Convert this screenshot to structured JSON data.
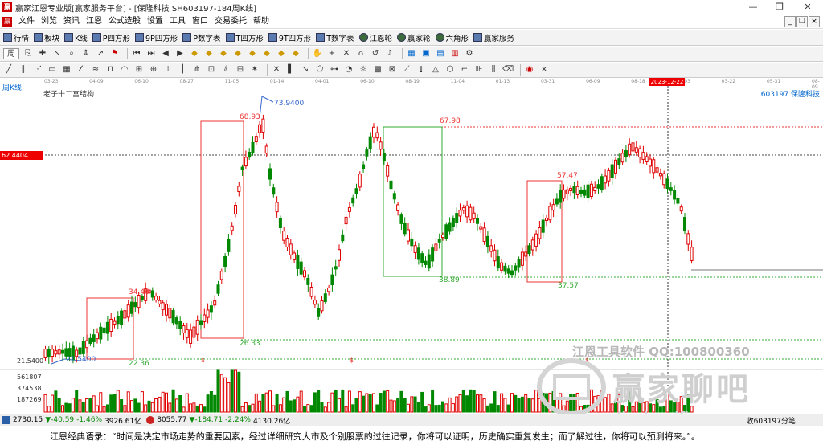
{
  "window": {
    "title": "赢家江恩专业版[赢家服务平台] - [保隆科技  SH603197-184周K线]",
    "minimize": "—",
    "maximize": "❐",
    "close": "✕",
    "mdi_minimize": "_",
    "mdi_restore": "❐",
    "mdi_close": "×"
  },
  "menu": [
    "文件",
    "浏览",
    "资讯",
    "江恩",
    "公式选股",
    "设置",
    "工具",
    "窗口",
    "交易委托",
    "帮助"
  ],
  "toolbar1": [
    "行情",
    "板块",
    "K线",
    "P四方形",
    "9P四方形",
    "P数字表",
    "T四方形",
    "9T四方形",
    "T数字表",
    "江恩轮",
    "赢家轮",
    "六角形",
    "赢家服务"
  ],
  "toolbar2": {
    "period": "周",
    "icons": [
      "copy-icon",
      "crosshair-icon",
      "pointer-icon",
      "zoom-icon",
      "adjust-icon",
      "cursor-icon",
      "flag-icon",
      "first-icon",
      "last-icon",
      "prev-icon",
      "next-icon",
      "diamond-1",
      "diamond-2",
      "diamond-3",
      "diamond-4",
      "diamond-5",
      "diamond-6",
      "diamond-7",
      "diamond-8",
      "hand-icon",
      "plus-icon",
      "cross-icon",
      "tag-icon",
      "reset-icon",
      "bell-icon",
      "table-icon",
      "save-icon",
      "print-icon",
      "config-icon",
      "settings-icon"
    ]
  },
  "date_axis": {
    "labels": [
      "03-23",
      "04-09",
      "06-10",
      "08-27",
      "11-05",
      "01-14",
      "04-01",
      "06-10",
      "08-19",
      "11-04",
      "01-13",
      "03-31",
      "06-09",
      "08-18",
      "11-03",
      "03-22",
      "05-31",
      "08-09"
    ],
    "highlight": "2023-12-22"
  },
  "chart": {
    "period_label": "周K线",
    "study_title": "老子十二宫结构",
    "stock": "603197  保隆科技",
    "current_price": "62.4404",
    "price_labels": [
      "73.9400",
      "68.93",
      "67.98",
      "57.47",
      "38.89",
      "37.57",
      "34.46",
      "26.33",
      "22.36",
      "21.5400"
    ],
    "y_min_label": "21.5400",
    "volume_labels": [
      "561807",
      "374538",
      "187269"
    ],
    "marker_symbol": "$"
  },
  "watermark": {
    "line1": "江恩工具软件  QQ:100800360",
    "line2": "赢家聊吧",
    "url": "liaoba.yjfiu.com"
  },
  "status": {
    "idx1_value": "2730.15",
    "idx1_change": "▼-40.59",
    "idx1_pct": "-1.46%",
    "idx1_amount": "3926.61亿",
    "idx2_value": "8055.77",
    "idx2_change": "▼-184.71",
    "idx2_pct": "-2.24%",
    "idx2_amount": "4130.26亿",
    "right_text": "收603197分笔"
  },
  "quote": "江恩经典语录：“时间是决定市场走势的重要因素，经过详细研究大市及个别股票的过往记录，你将可以证明，历史确实重复发生；而了解过往，你将可以预测将来。”。",
  "colors": {
    "up": "#e00000",
    "down": "#008800",
    "accent_red": "#e00000",
    "link_blue": "#0066cc"
  }
}
